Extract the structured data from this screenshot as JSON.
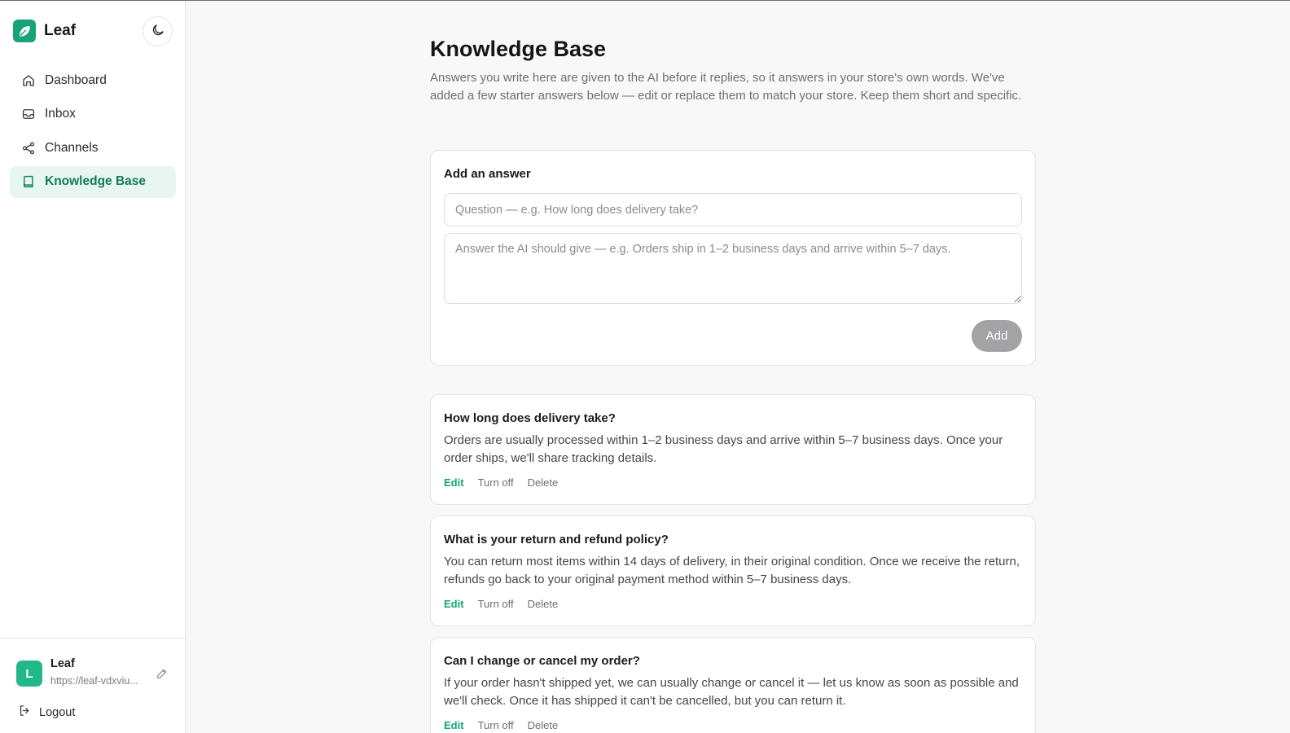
{
  "app": {
    "name": "Leaf"
  },
  "colors": {
    "accent": "#16a37a",
    "active_bg": "#e7f6f0",
    "disabled_button": "#a3a3a6"
  },
  "sidebar": {
    "items": [
      {
        "label": "Dashboard",
        "icon": "home-icon",
        "active": false
      },
      {
        "label": "Inbox",
        "icon": "inbox-icon",
        "active": false
      },
      {
        "label": "Channels",
        "icon": "share-icon",
        "active": false
      },
      {
        "label": "Knowledge Base",
        "icon": "book-icon",
        "active": true
      }
    ],
    "account": {
      "initial": "L",
      "name": "Leaf",
      "url": "https://leaf-vdxviu..."
    },
    "logout_label": "Logout"
  },
  "main": {
    "title": "Knowledge Base",
    "description": "Answers you write here are given to the AI before it replies, so it answers in your store's own words. We've added a few starter answers below — edit or replace them to match your store. Keep them short and specific.",
    "add_form": {
      "title": "Add an answer",
      "question_placeholder": "Question — e.g. How long does delivery take?",
      "question_value": "",
      "answer_placeholder": "Answer the AI should give — e.g. Orders ship in 1–2 business days and arrive within 5–7 days.",
      "answer_value": "",
      "add_label": "Add"
    },
    "entries": [
      {
        "question": "How long does delivery take?",
        "answer": "Orders are usually processed within 1–2 business days and arrive within 5–7 business days. Once your order ships, we'll share tracking details.",
        "edit_label": "Edit",
        "toggle_label": "Turn off",
        "delete_label": "Delete"
      },
      {
        "question": "What is your return and refund policy?",
        "answer": "You can return most items within 14 days of delivery, in their original condition. Once we receive the return, refunds go back to your original payment method within 5–7 business days.",
        "edit_label": "Edit",
        "toggle_label": "Turn off",
        "delete_label": "Delete"
      },
      {
        "question": "Can I change or cancel my order?",
        "answer": "If your order hasn't shipped yet, we can usually change or cancel it — let us know as soon as possible and we'll check. Once it has shipped it can't be cancelled, but you can return it.",
        "edit_label": "Edit",
        "toggle_label": "Turn off",
        "delete_label": "Delete"
      }
    ]
  }
}
